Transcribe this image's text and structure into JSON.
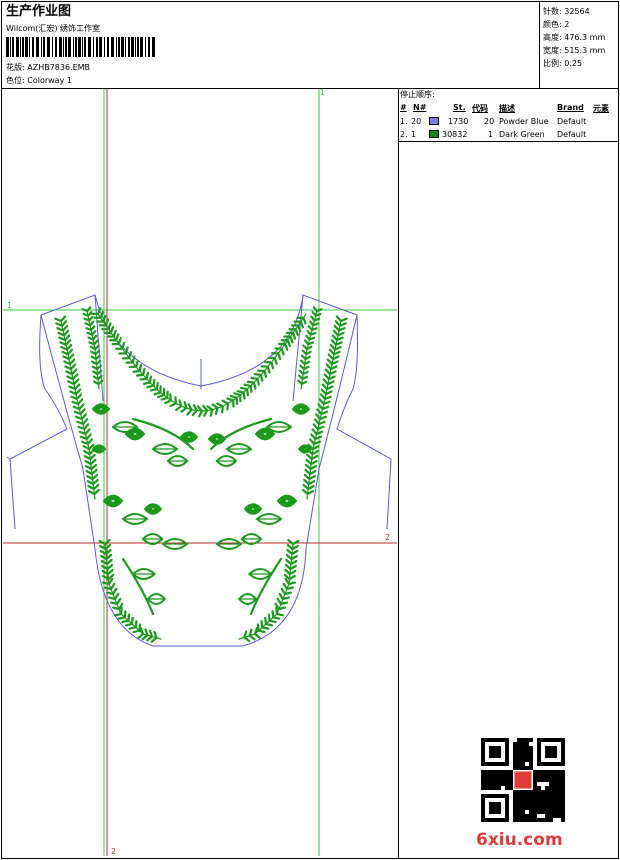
{
  "header": {
    "title": "生产作业图",
    "studio": "Wilcom(汇宏) 绣饰工作室",
    "design_label": "花版: AZHB7836.EMB",
    "colorway_label": "色位: Colorway 1"
  },
  "info": {
    "stitches": "针数: 32564",
    "colors": "颜色: 2",
    "height": "高度: 476.3 mm",
    "width": "宽度: 515.3 mm",
    "scale": "比例: 0.25"
  },
  "stop_sequence": {
    "title": "停止顺序:",
    "columns": [
      "#",
      "N#",
      "St.",
      "代码",
      "描述",
      "Brand",
      "元素"
    ],
    "rows": [
      {
        "idx": "1.",
        "n": "20",
        "color": "#7b7bf0",
        "st": "1730",
        "code": "20",
        "desc": "Powder Blue",
        "brand": "Default"
      },
      {
        "idx": "2.",
        "n": "1",
        "color": "#0a8a0a",
        "st": "30832",
        "code": "1",
        "desc": "Dark Green",
        "brand": "Default"
      }
    ]
  },
  "guides": {
    "label_top_green": "1",
    "label_left_green": "1",
    "label_right_red": "2",
    "label_bottom_red": "2"
  },
  "colors": {
    "embroidery_green": "#1a9a1a",
    "outline_blue": "#5a5ae0",
    "guide_green": "#2ecc40",
    "guide_red": "#c0282c",
    "watermark_red": "#e03a3a"
  },
  "watermark": {
    "site": "6xiu.com"
  }
}
